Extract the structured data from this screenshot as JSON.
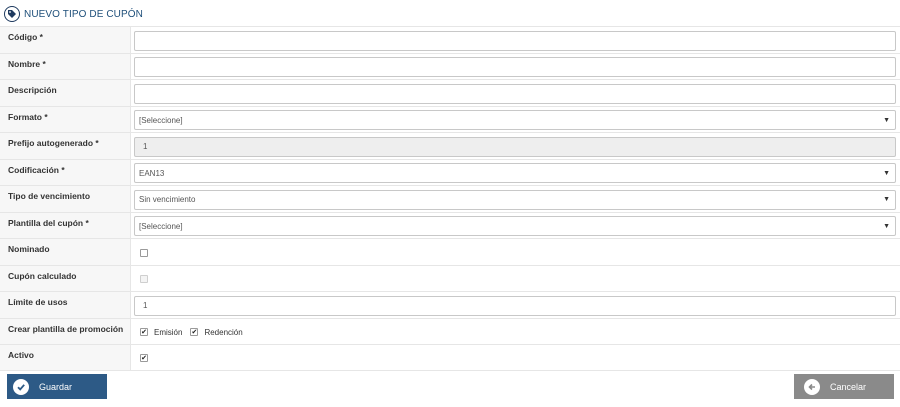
{
  "header": {
    "title": "NUEVO TIPO DE CUPÓN",
    "icon": "tag-icon"
  },
  "fields": {
    "codigo": {
      "label": "Código *",
      "value": ""
    },
    "nombre": {
      "label": "Nombre *",
      "value": ""
    },
    "descripcion": {
      "label": "Descripción",
      "value": ""
    },
    "formato": {
      "label": "Formato *",
      "value": "[Seleccione]"
    },
    "prefijo": {
      "label": "Prefijo autogenerado *",
      "value": "1"
    },
    "codificacion": {
      "label": "Codificación *",
      "value": "EAN13"
    },
    "tipo_vencimiento": {
      "label": "Tipo de vencimiento",
      "value": "Sin vencimiento"
    },
    "plantilla": {
      "label": "Plantilla del cupón *",
      "value": "[Seleccione]"
    },
    "nominado": {
      "label": "Nominado",
      "checked": false
    },
    "cupon_calculado": {
      "label": "Cupón calculado",
      "checked": false,
      "disabled": true
    },
    "limite_usos": {
      "label": "Límite de usos",
      "value": "1"
    },
    "crear_plantilla": {
      "label": "Crear plantilla de promoción",
      "emision_label": "Emisión",
      "emision_checked": true,
      "redencion_label": "Redención",
      "redencion_checked": true
    },
    "activo": {
      "label": "Activo",
      "checked": true
    }
  },
  "buttons": {
    "save_label": "Guardar",
    "cancel_label": "Cancelar"
  },
  "colors": {
    "primary": "#2d5a86",
    "secondary": "#8a8a8a",
    "title": "#1e4f7a"
  }
}
